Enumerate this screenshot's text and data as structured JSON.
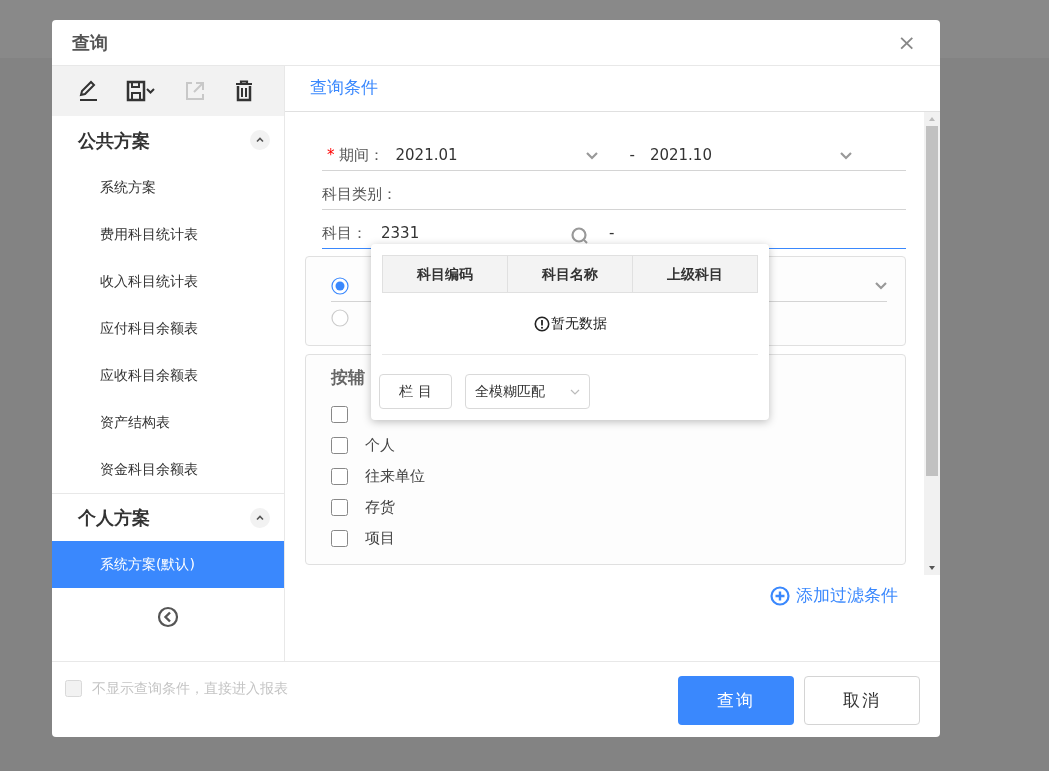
{
  "dialog": {
    "title": "查询",
    "close": "×"
  },
  "sidebar": {
    "toolbar": [
      {
        "kind": "edit",
        "disabled": false
      },
      {
        "kind": "save",
        "disabled": false
      },
      {
        "kind": "export",
        "disabled": true
      },
      {
        "kind": "delete",
        "disabled": false
      }
    ],
    "groups": [
      {
        "title": "公共方案",
        "expanded": true,
        "items": [
          {
            "label": "系统方案",
            "selected": false
          },
          {
            "label": "费用科目统计表",
            "selected": false
          },
          {
            "label": "收入科目统计表",
            "selected": false
          },
          {
            "label": "应付科目余额表",
            "selected": false
          },
          {
            "label": "应收科目余额表",
            "selected": false
          },
          {
            "label": "资产结构表",
            "selected": false
          },
          {
            "label": "资金科目余额表",
            "selected": false
          }
        ]
      },
      {
        "title": "个人方案",
        "expanded": true,
        "items": [
          {
            "label": "系统方案(默认)",
            "selected": true
          }
        ]
      }
    ]
  },
  "tabs": [
    {
      "label": "查询条件",
      "selected": true
    }
  ],
  "fields": [
    {
      "kind": "range",
      "required_mark": "*",
      "label": "期间：",
      "from": "2021.01",
      "separator": "-",
      "to": "2021.10",
      "focused": false
    },
    {
      "kind": "text",
      "label": "科目类别：",
      "focused": false
    },
    {
      "kind": "search",
      "label": "科目：",
      "value": "2331",
      "separator": "-",
      "focused": true
    }
  ],
  "radio_options": [
    {
      "selected": true
    },
    {
      "selected": false
    }
  ],
  "aux_panel": {
    "title": "按辅",
    "options": [
      {
        "checked": false
      },
      {
        "label": "个人",
        "checked": false
      },
      {
        "label": "往来单位",
        "checked": false
      },
      {
        "label": "存货",
        "checked": false
      },
      {
        "label": "项目",
        "checked": false
      }
    ]
  },
  "add_filter": "添加过滤条件",
  "popup": {
    "columns": [
      "科目编码",
      "科目名称",
      "上级科目"
    ],
    "empty_text": "暂无数据",
    "columns_button": "栏 目",
    "match_select": "全模糊匹配"
  },
  "footer": {
    "skip_option": {
      "label": "不显示查询条件，直接进入报表",
      "checked": false,
      "disabled": true
    },
    "buttons": [
      {
        "label": "查询",
        "kind": "primary"
      },
      {
        "label": "取消",
        "kind": "default"
      }
    ]
  }
}
